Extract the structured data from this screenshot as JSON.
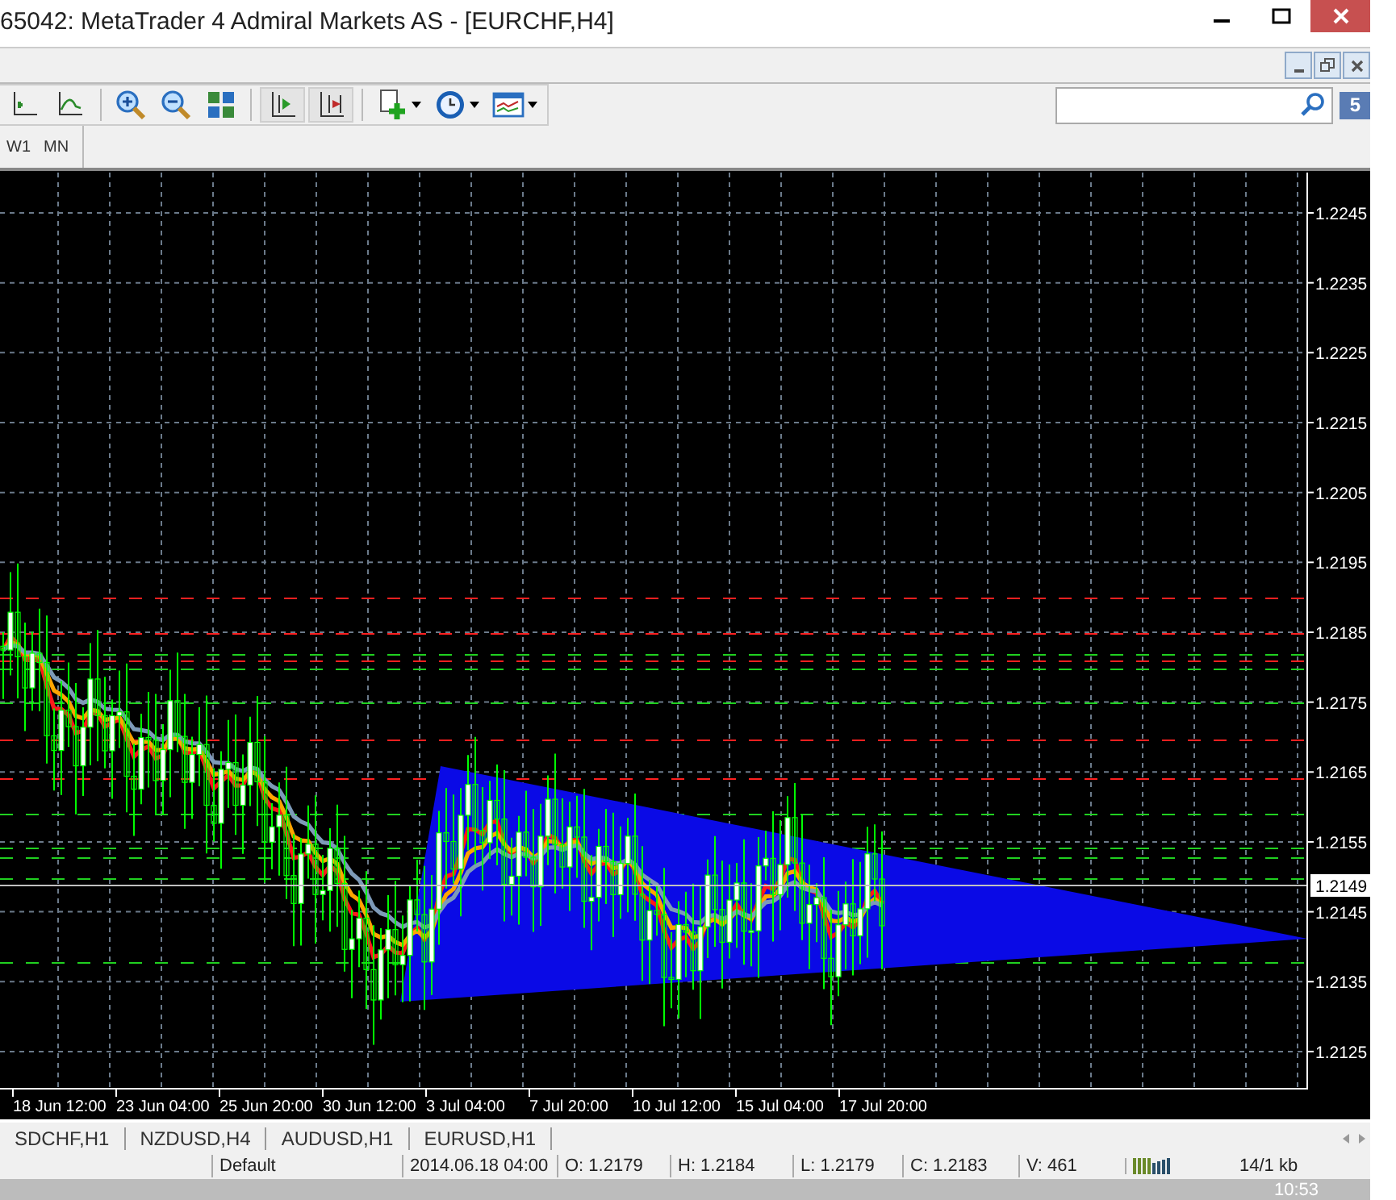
{
  "window": {
    "title": "65042: MetaTrader 4 Admiral Markets AS - [EURCHF,H4]"
  },
  "notifications": {
    "count": "5"
  },
  "periods": [
    {
      "label": "W1"
    },
    {
      "label": "MN"
    }
  ],
  "chart": {
    "price_labels": [
      "1.2245",
      "1.2235",
      "1.2225",
      "1.2215",
      "1.2205",
      "1.2195",
      "1.2185",
      "1.2175",
      "1.2165",
      "1.2155",
      "1.2145",
      "1.2135",
      "1.2125"
    ],
    "current_price": "1.2149",
    "time_labels": [
      "18 Jun 12:00",
      "23 Jun 04:00",
      "25 Jun 20:00",
      "30 Jun 12:00",
      "3 Jul 04:00",
      "7 Jul 20:00",
      "10 Jul 12:00",
      "15 Jul 04:00",
      "17 Jul 20:00"
    ]
  },
  "tabs": [
    {
      "label": "SDCHF,H1"
    },
    {
      "label": "NZDUSD,H4"
    },
    {
      "label": "AUDUSD,H1"
    },
    {
      "label": "EURUSD,H1"
    }
  ],
  "status_bar": {
    "profile": "Default",
    "datetime": "2014.06.18 04:00",
    "open": "O: 1.2179",
    "high": "H: 1.2184",
    "low": "L: 1.2179",
    "close": "C: 1.2183",
    "volume": "V: 461",
    "traffic": "14/1 kb"
  },
  "taskbar": {
    "clock": "10:53"
  }
}
